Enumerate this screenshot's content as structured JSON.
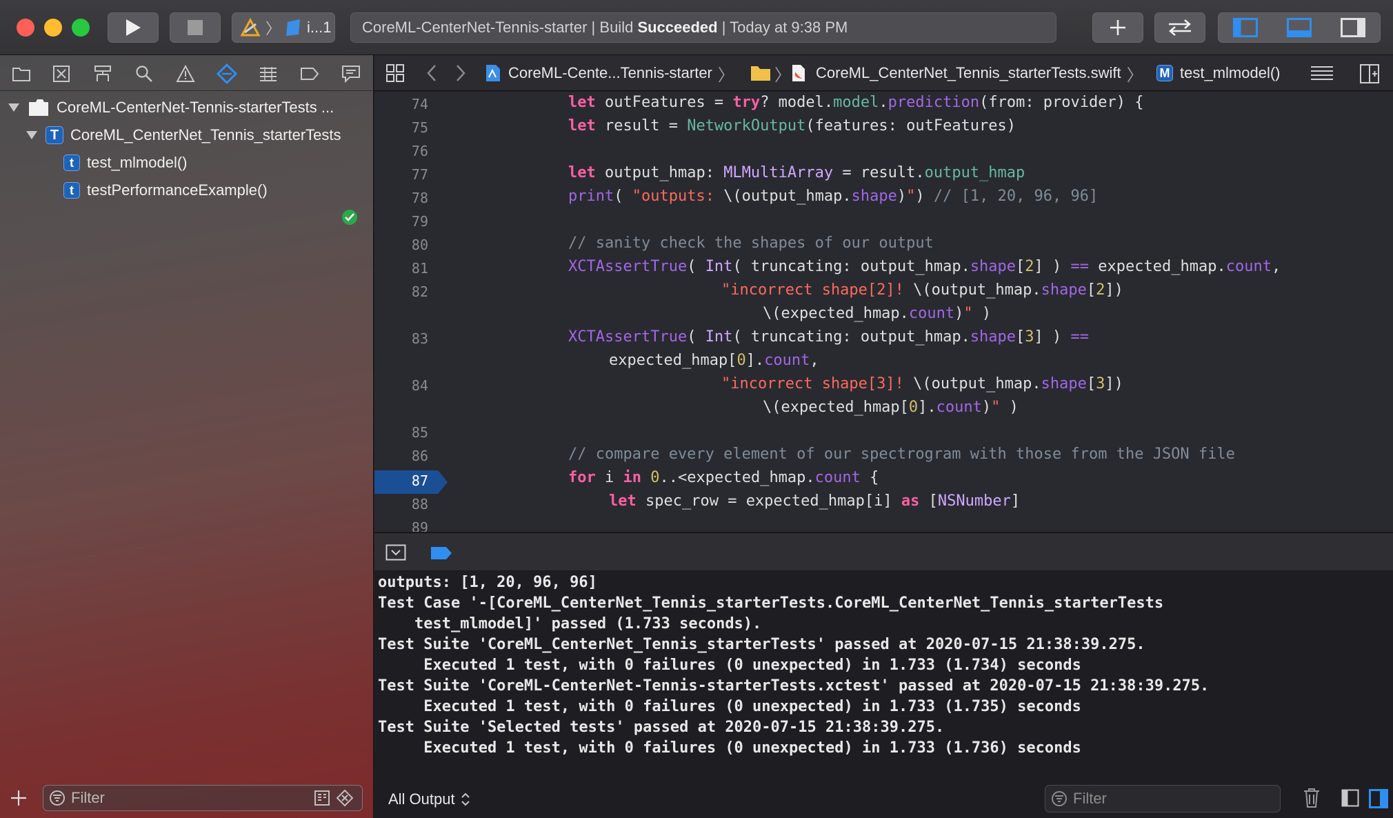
{
  "toolbar": {
    "scheme_label": "i...1",
    "activity": {
      "project": "CoreML-CenterNet-Tennis-starter",
      "sep1": " | ",
      "build_prefix": "Build ",
      "build_status": "Succeeded",
      "sep2": " | ",
      "time": "Today at 9:38 PM"
    }
  },
  "navigator": {
    "tree": [
      {
        "label": "CoreML-CenterNet-Tennis-starterTests ...",
        "badge": ""
      },
      {
        "label": "CoreML_CenterNet_Tennis_starterTests",
        "badge": "T"
      },
      {
        "label": "test_mlmodel()",
        "badge": "t"
      },
      {
        "label": "testPerformanceExample()",
        "badge": "t"
      }
    ],
    "filter_placeholder": "Filter"
  },
  "jumpbar": {
    "project": "CoreML-Cente...Tennis-starter",
    "file": "CoreML_CenterNet_Tennis_starterTests.swift",
    "method_badge": "M",
    "method": "test_mlmodel()"
  },
  "editor": {
    "line_numbers": [
      "74",
      "75",
      "76",
      "77",
      "78",
      "79",
      "80",
      "81",
      "82",
      "",
      "83",
      "",
      "84",
      "",
      "85",
      "86",
      "87",
      "88",
      "89"
    ],
    "current_line": "87"
  },
  "console": {
    "lines": [
      "outputs: [1, 20, 96, 96]",
      "Test Case '-[CoreML_CenterNet_Tennis_starterTests.CoreML_CenterNet_Tennis_starterTests",
      "    test_mlmodel]' passed (1.733 seconds).",
      "Test Suite 'CoreML_CenterNet_Tennis_starterTests' passed at 2020-07-15 21:38:39.275.",
      "     Executed 1 test, with 0 failures (0 unexpected) in 1.733 (1.734) seconds",
      "Test Suite 'CoreML-CenterNet-Tennis-starterTests.xctest' passed at 2020-07-15 21:38:39.275.",
      "     Executed 1 test, with 0 failures (0 unexpected) in 1.733 (1.735) seconds",
      "Test Suite 'Selected tests' passed at 2020-07-15 21:38:39.275.",
      "     Executed 1 test, with 0 failures (0 unexpected) in 1.733 (1.736) seconds"
    ],
    "output_selector": "All Output",
    "filter_placeholder": "Filter"
  },
  "code": {
    "l74": {
      "kw1": "let",
      "t1": " outFeatures = ",
      "kw2": "try",
      "t2": "? model.",
      "p1": "model",
      "t3": ".",
      "p2": "prediction",
      "t4": "(from: provider) {"
    },
    "l75": {
      "kw1": "let",
      "t1": " result = ",
      "f1": "NetworkOutput",
      "t2": "(features: outFeatures)"
    },
    "l77": {
      "kw1": "let",
      "t1": " output_hmap: ",
      "ty1": "MLMultiArray",
      "t2": " = result.",
      "f1": "output_hmap"
    },
    "l78": {
      "p1": "print",
      "t1": "( ",
      "s1": "\"outputs: ",
      "t2": "\\(output_hmap.",
      "p2": "shape",
      "t3": ")",
      "s2": "\"",
      "t4": ") ",
      "c1": "// [1, 20, 96, 96]"
    },
    "l80": {
      "c1": "// sanity check the shapes of our output"
    },
    "l81": {
      "p1": "XCTAssertTrue",
      "t1": "( ",
      "ty1": "Int",
      "t2": "( truncating: output_hmap.",
      "p2": "shape",
      "t3": "[",
      "n1": "2",
      "t4": "] ) ",
      "p3": "==",
      "t5": " expected_hmap.",
      "p4": "count",
      "t6": ","
    },
    "l82a": {
      "s1": "\"incorrect shape[2]! ",
      "t1": "\\(output_hmap.",
      "p1": "shape",
      "t2": "[",
      "n1": "2",
      "t3": "])"
    },
    "l82b": {
      "t1": "\\(expected_hmap.",
      "p1": "count",
      "t2": ")",
      "s1": "\"",
      "t3": " )"
    },
    "l83a": {
      "p1": "XCTAssertTrue",
      "t1": "( ",
      "ty1": "Int",
      "t2": "( truncating: output_hmap.",
      "p2": "shape",
      "t3": "[",
      "n1": "3",
      "t4": "] ) ",
      "p3": "=="
    },
    "l83b": {
      "t1": "expected_hmap[",
      "n1": "0",
      "t2": "].",
      "p1": "count",
      "t3": ","
    },
    "l84a": {
      "s1": "\"incorrect shape[3]! ",
      "t1": "\\(output_hmap.",
      "p1": "shape",
      "t2": "[",
      "n1": "3",
      "t3": "])"
    },
    "l84b": {
      "t1": "\\(expected_hmap[",
      "n1": "0",
      "t2": "].",
      "p1": "count",
      "t3": ")",
      "s1": "\"",
      "t4": " )"
    },
    "l86": {
      "c1": "// compare every element of our spectrogram with those from the JSON file"
    },
    "l87": {
      "kw1": "for",
      "t1": " i ",
      "kw2": "in",
      "t2": " ",
      "n1": "0",
      "t3": "..<expected_hmap.",
      "p1": "count",
      "t4": " {"
    },
    "l88": {
      "kw1": "let",
      "t1": " spec_row = expected_hmap[i] ",
      "kw2": "as",
      "t2": " [",
      "ty1": "NSNumber",
      "t3": "]"
    }
  }
}
